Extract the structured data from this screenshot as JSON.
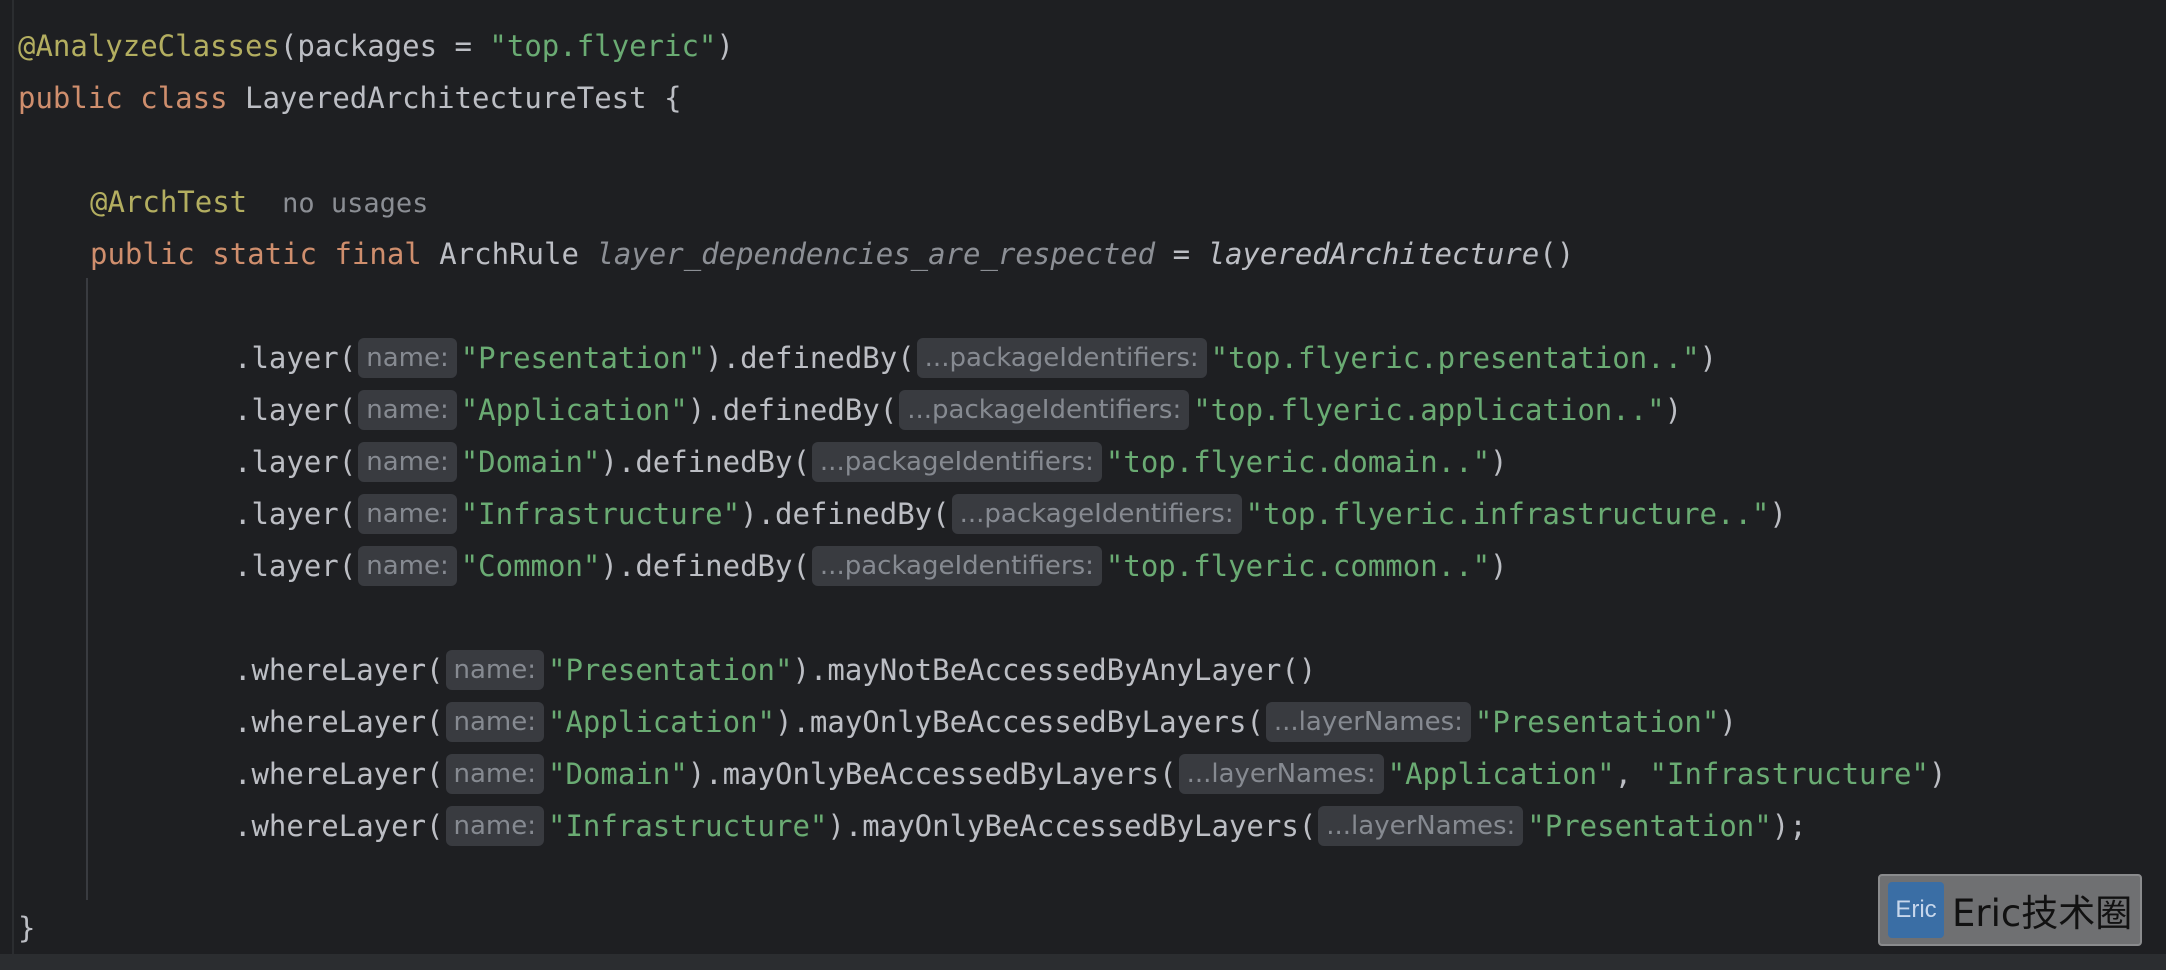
{
  "code": {
    "l1": {
      "annotation": "@AnalyzeClasses",
      "open": "(packages = ",
      "value": "\"top.flyeric\"",
      "close": ")"
    },
    "l2": {
      "kw_public": "public",
      "kw_class": "class",
      "class_name": "LayeredArchitectureTest",
      "brace": "{"
    },
    "l4": {
      "annotation": "@ArchTest",
      "usage_hint": "no usages"
    },
    "l5": {
      "kw_public": "public",
      "kw_static": "static",
      "kw_final": "final",
      "type": "ArchRule",
      "field": "layer_dependencies_are_respected",
      "assign": "=",
      "method": "layeredArchitecture",
      "parens": "()"
    },
    "layers": [
      {
        "call": ".layer(",
        "hint_name": "name:",
        "name": "\"Presentation\"",
        "mid": ").definedBy(",
        "hint_pkg": "...packageIdentifiers:",
        "pkg": "\"top.flyeric.presentation..\"",
        "end": ")"
      },
      {
        "call": ".layer(",
        "hint_name": "name:",
        "name": "\"Application\"",
        "mid": ").definedBy(",
        "hint_pkg": "...packageIdentifiers:",
        "pkg": "\"top.flyeric.application..\"",
        "end": ")"
      },
      {
        "call": ".layer(",
        "hint_name": "name:",
        "name": "\"Domain\"",
        "mid": ").definedBy(",
        "hint_pkg": "...packageIdentifiers:",
        "pkg": "\"top.flyeric.domain..\"",
        "end": ")"
      },
      {
        "call": ".layer(",
        "hint_name": "name:",
        "name": "\"Infrastructure\"",
        "mid": ").definedBy(",
        "hint_pkg": "...packageIdentifiers:",
        "pkg": "\"top.flyeric.infrastructure..\"",
        "end": ")"
      },
      {
        "call": ".layer(",
        "hint_name": "name:",
        "name": "\"Common\"",
        "mid": ").definedBy(",
        "hint_pkg": "...packageIdentifiers:",
        "pkg": "\"top.flyeric.common..\"",
        "end": ")"
      }
    ],
    "where": [
      {
        "call": ".whereLayer(",
        "hint_name": "name:",
        "name": "\"Presentation\"",
        "rest": ").mayNotBeAccessedByAnyLayer()"
      },
      {
        "call": ".whereLayer(",
        "hint_name": "name:",
        "name": "\"Application\"",
        "mid": ").mayOnlyBeAccessedByLayers(",
        "hint_layers": "...layerNames:",
        "v1": "\"Presentation\"",
        "end": ")"
      },
      {
        "call": ".whereLayer(",
        "hint_name": "name:",
        "name": "\"Domain\"",
        "mid": ").mayOnlyBeAccessedByLayers(",
        "hint_layers": "...layerNames:",
        "v1": "\"Application\"",
        "comma": ", ",
        "v2": "\"Infrastructure\"",
        "end": ")"
      },
      {
        "call": ".whereLayer(",
        "hint_name": "name:",
        "name": "\"Infrastructure\"",
        "mid": ").mayOnlyBeAccessedByLayers(",
        "hint_layers": "...layerNames:",
        "v1": "\"Presentation\"",
        "end": ");"
      }
    ],
    "closing_brace": "}"
  },
  "watermark": {
    "badge": "Eric",
    "text": "Eric技术圈"
  },
  "colors": {
    "background": "#1e1f22",
    "keyword": "#cf8e6d",
    "string": "#6aab73",
    "annotation": "#b3ae60",
    "text": "#bcbec4",
    "hint_bg": "#393b40"
  }
}
